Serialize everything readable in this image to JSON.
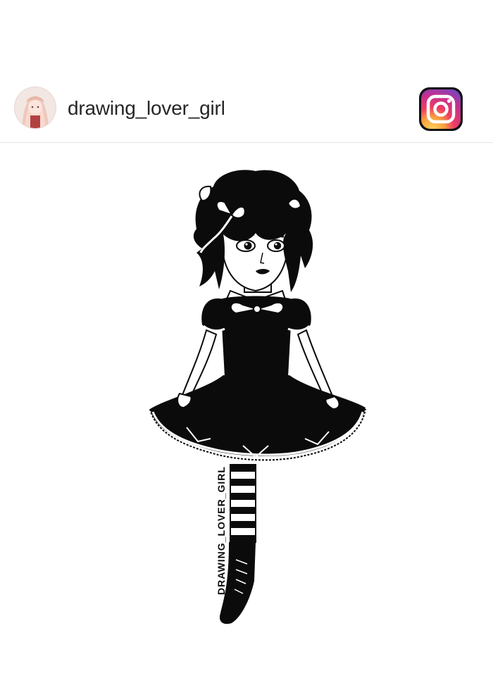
{
  "post": {
    "username": "drawing_lover_girl",
    "avatar_icon": "user-avatar-icon",
    "brand_icon": "instagram-logo-icon"
  },
  "artwork": {
    "watermark": "DRAWING_LOVER_GIRL",
    "ink_color": "#0b0b0b",
    "paper_color": "#ffffff"
  },
  "colors": {
    "instagram_gradient": [
      "#f8cf5a",
      "#f06c3f",
      "#d62976",
      "#962fbf",
      "#4f5bd5"
    ]
  }
}
